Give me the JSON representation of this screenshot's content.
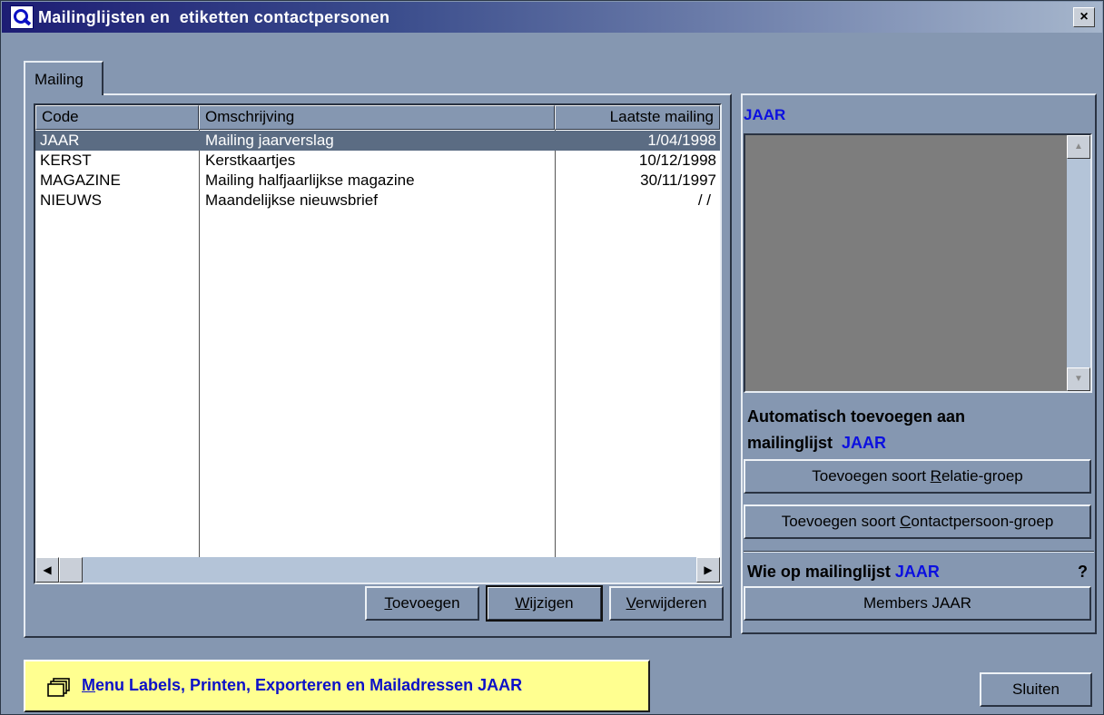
{
  "window": {
    "title": "Mailinglijsten en  etiketten contactpersonen",
    "close_label": "×"
  },
  "tabs": [
    {
      "label": "Mailing",
      "active": true
    }
  ],
  "list": {
    "columns": [
      "Code",
      "Omschrijving",
      "Laatste mailing"
    ],
    "rows": [
      {
        "code": "JAAR",
        "description": "Mailing jaarverslag",
        "last_mailing": "1/04/1998",
        "selected": true
      },
      {
        "code": "KERST",
        "description": "Kerstkaartjes",
        "last_mailing": "10/12/1998",
        "selected": false
      },
      {
        "code": "MAGAZINE",
        "description": "Mailing halfjaarlijkse magazine",
        "last_mailing": "30/11/1997",
        "selected": false
      },
      {
        "code": "NIEUWS",
        "description": "Maandelijkse nieuwsbrief",
        "last_mailing": "/ /",
        "selected": false
      }
    ]
  },
  "buttons": {
    "add": {
      "mnemonic": "T",
      "rest": "oevoegen"
    },
    "edit": {
      "mnemonic": "W",
      "rest": "ijzigen"
    },
    "delete": {
      "mnemonic": "V",
      "rest": "erwijderen"
    },
    "close": "Sluiten"
  },
  "right": {
    "selected_code": "JAAR",
    "auto_add_line1": "Automatisch toevoegen aan",
    "auto_add_line2": "mailinglijst",
    "add_relation_group": {
      "pre": "Toevoegen soort ",
      "mnemonic": "R",
      "post": "elatie-groep"
    },
    "add_contact_group": {
      "pre": "Toevoegen soort ",
      "mnemonic": "C",
      "post": "ontactpersoon-groep"
    },
    "who_on_list": "Wie op mailinglijst",
    "question": "?",
    "members": "Members JAAR"
  },
  "menu_button": {
    "mnemonic": "M",
    "rest": "enu Labels, Printen, Exporteren en Mailadressen JAAR"
  },
  "colors": {
    "selected_row": "#5b6c83",
    "accent_blue": "#0c10e0",
    "menu_bg": "#ffff90",
    "window_bg": "#8597b1"
  }
}
